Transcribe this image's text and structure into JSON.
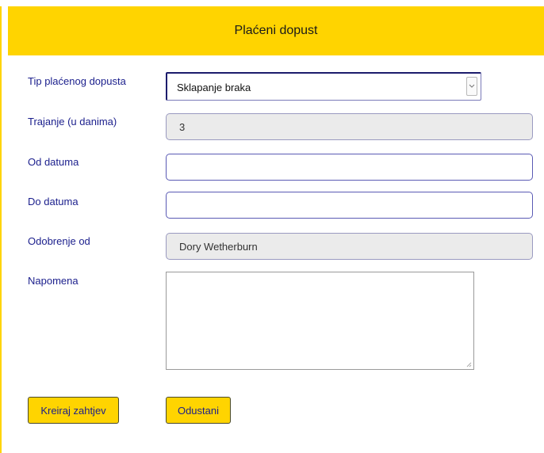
{
  "header": {
    "title": "Plaćeni dopust"
  },
  "form": {
    "leave_type": {
      "label": "Tip plaćenog dopusta",
      "value": "Sklapanje braka"
    },
    "duration": {
      "label": "Trajanje (u danima)",
      "value": "3"
    },
    "date_from": {
      "label": "Od datuma",
      "value": ""
    },
    "date_to": {
      "label": "Do datuma",
      "value": ""
    },
    "approved_by": {
      "label": "Odobrenje od",
      "value": "Dory Wetherburn"
    },
    "note": {
      "label": "Napomena",
      "value": ""
    }
  },
  "actions": {
    "create_label": "Kreiraj zahtjev",
    "cancel_label": "Odustani"
  },
  "colors": {
    "accent": "#ffd400",
    "label_text": "#1a1e8c",
    "readonly_bg": "#ebebeb"
  },
  "icons": {
    "select_arrow": "chevron-down-icon",
    "textarea_grip": "resize-grip-icon"
  }
}
